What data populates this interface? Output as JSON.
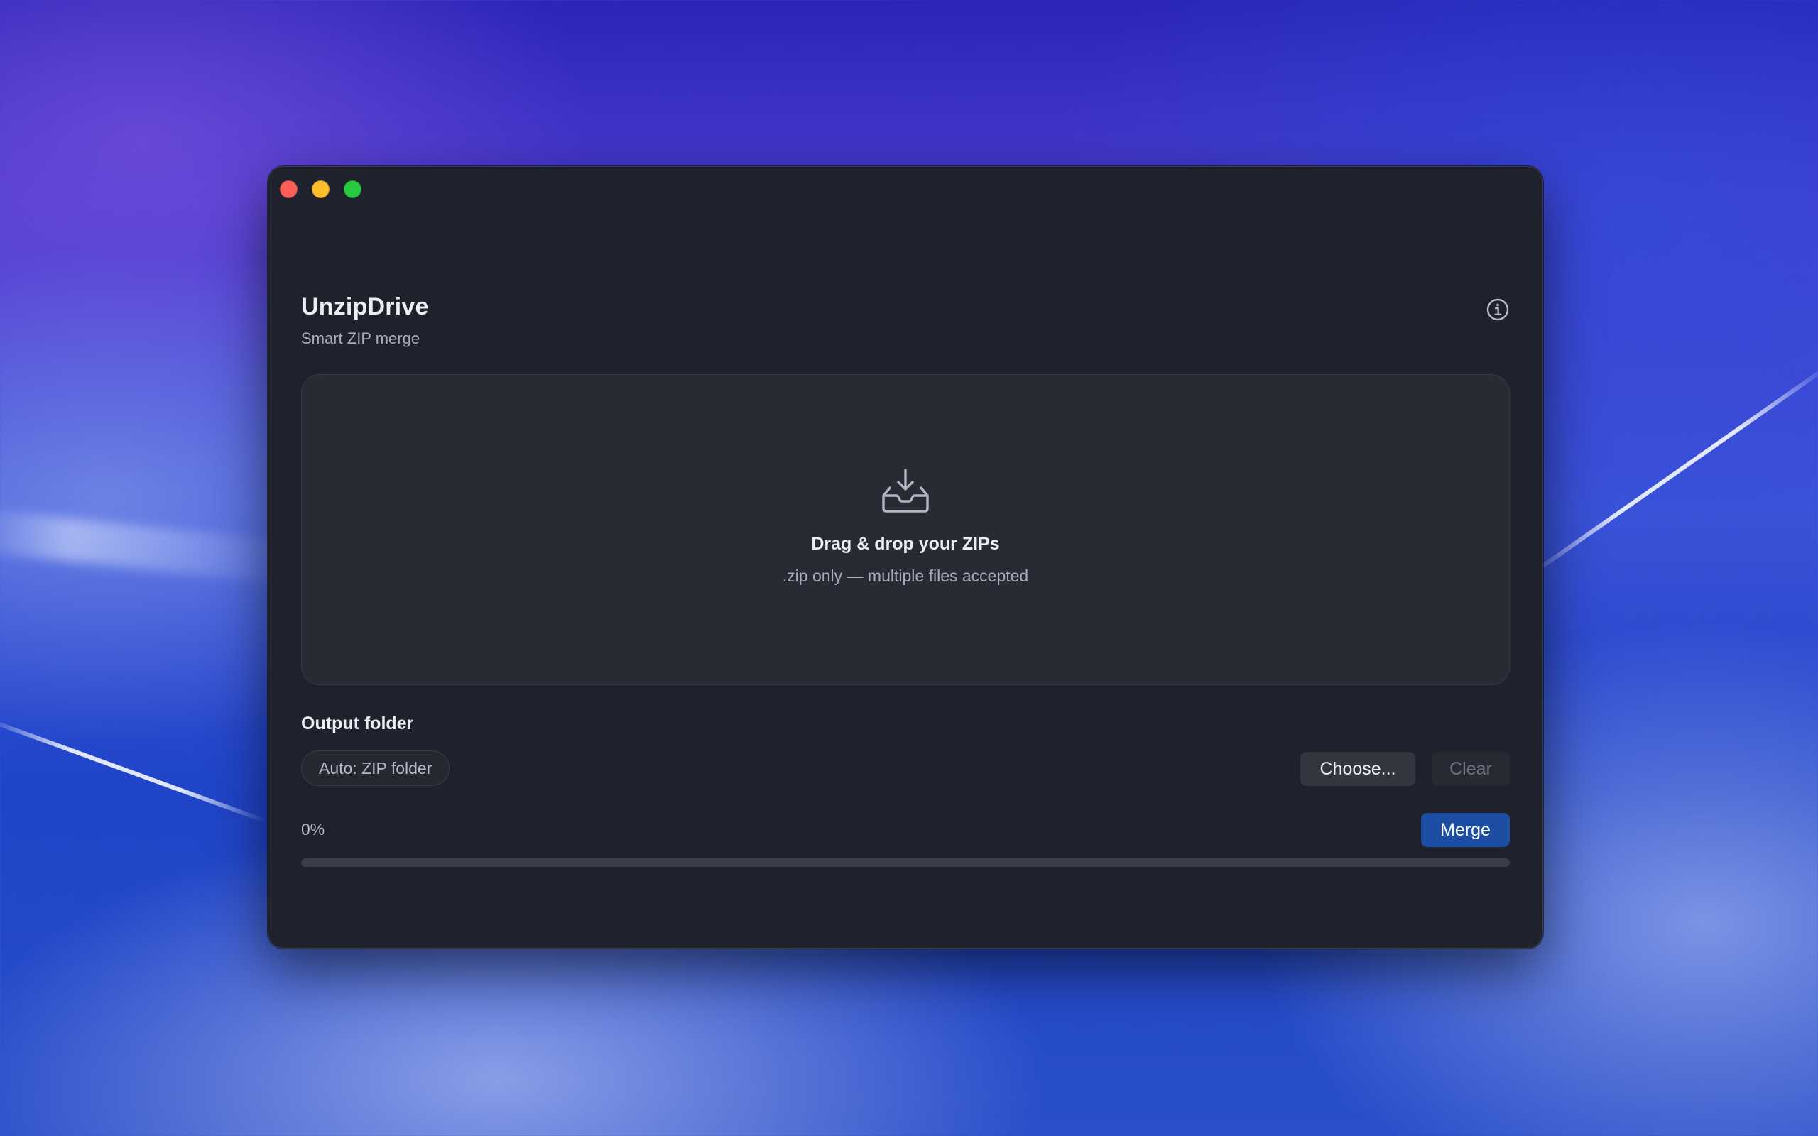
{
  "window": {
    "controls": {
      "close_color": "#ff5f57",
      "minimize_color": "#febc2e",
      "zoom_color": "#28c840"
    }
  },
  "header": {
    "title": "UnzipDrive",
    "subtitle": "Smart ZIP merge",
    "info_icon": "info-circle-icon"
  },
  "dropzone": {
    "icon": "inbox-download-icon",
    "title": "Drag & drop your ZIPs",
    "subtitle": ".zip only — multiple files accepted"
  },
  "output": {
    "label": "Output folder",
    "current_value": "Auto: ZIP folder",
    "choose_label": "Choose...",
    "clear_label": "Clear",
    "clear_enabled": false
  },
  "progress": {
    "label": "0%",
    "fraction": 0
  },
  "actions": {
    "merge_label": "Merge",
    "accent_color": "#1d4ea3"
  }
}
